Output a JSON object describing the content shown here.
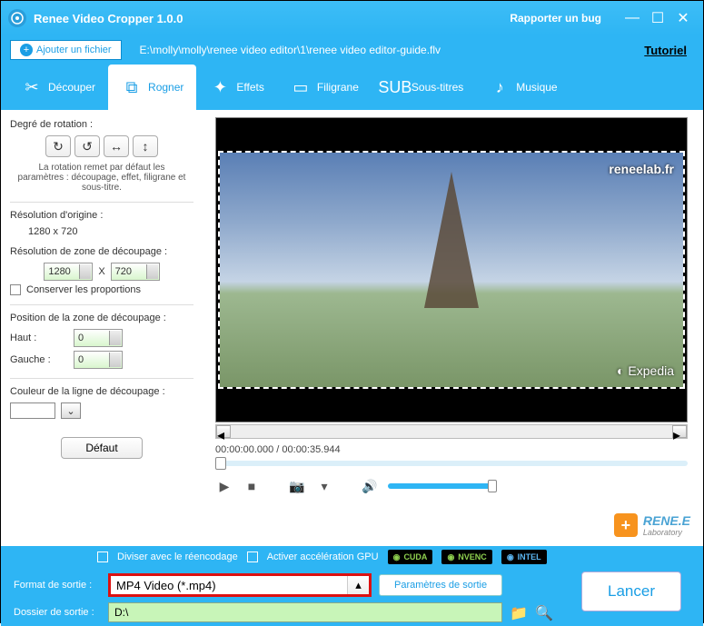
{
  "titlebar": {
    "app_name": "Renee Video Cropper 1.0.0",
    "bug_report": "Rapporter un bug"
  },
  "toolbar": {
    "add_file": "Ajouter un fichier",
    "file_path": "E:\\molly\\molly\\renee video editor\\1\\renee video editor-guide.flv",
    "tutorial": "Tutoriel"
  },
  "tabs": {
    "cut": "Découper",
    "crop": "Rogner",
    "effects": "Effets",
    "watermark": "Filigrane",
    "subtitles": "Sous-titres",
    "music": "Musique"
  },
  "sidebar": {
    "rotation_label": "Degré de rotation :",
    "rotation_note": "La rotation remet par défaut les paramètres : découpage, effet, filigrane et sous-titre.",
    "original_res_label": "Résolution d'origine :",
    "original_res_value": "1280 x 720",
    "crop_res_label": "Résolution de zone de découpage :",
    "width": "1280",
    "height": "720",
    "x_label": "X",
    "keep_ratio": "Conserver les proportions",
    "crop_pos_label": "Position de la zone de découpage :",
    "top_label": "Haut :",
    "top_value": "0",
    "left_label": "Gauche :",
    "left_value": "0",
    "line_color_label": "Couleur de la ligne de découpage :",
    "default_btn": "Défaut"
  },
  "preview": {
    "watermark_text": "reneelab.fr",
    "expedia_text": "Expedia",
    "timecode": "00:00:00.000 / 00:00:35.944"
  },
  "options": {
    "split_reencode": "Diviser avec le réencodage",
    "gpu_accel": "Activer accélération GPU",
    "cuda": "CUDA",
    "nvenc": "NVENC",
    "intel": "INTEL"
  },
  "bottom": {
    "format_label": "Format de sortie :",
    "format_value": "MP4 Video (*.mp4)",
    "settings_btn": "Paramètres de sortie",
    "folder_label": "Dossier de sortie :",
    "folder_value": "D:\\",
    "launch": "Lancer"
  },
  "logo": {
    "brand": "RENE.E",
    "sub": "Laboratory"
  }
}
